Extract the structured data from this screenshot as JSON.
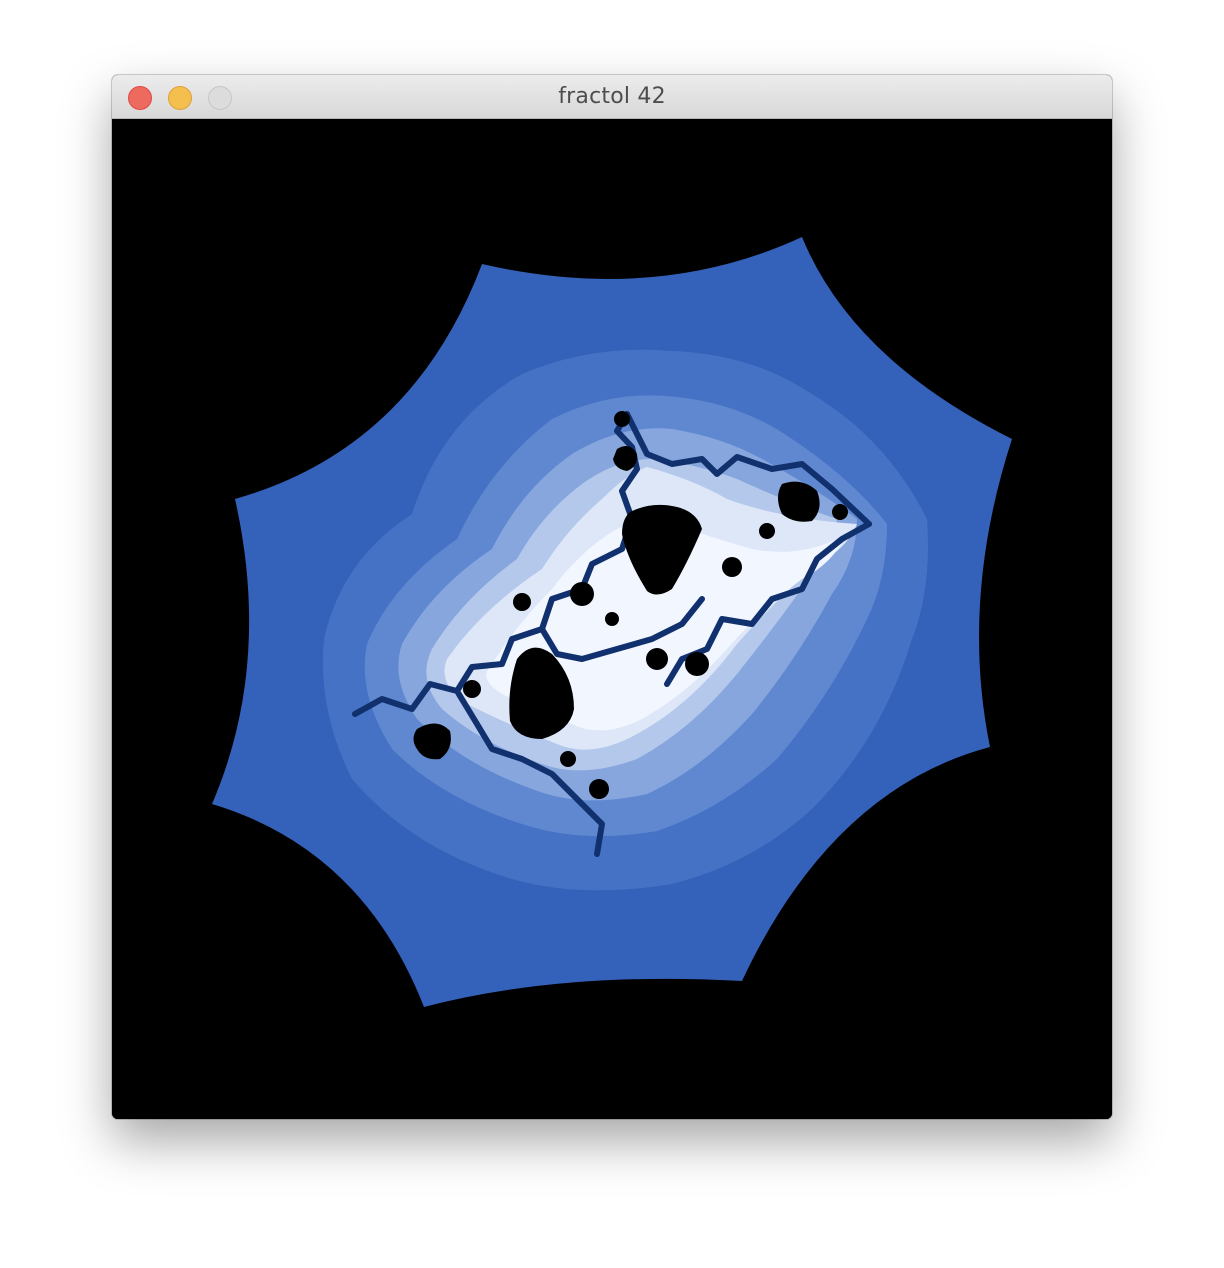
{
  "window": {
    "title": "fractol 42",
    "buttons": {
      "close": {
        "icon": "close-icon",
        "color": "#ed6a5e"
      },
      "minimize": {
        "icon": "minimize-icon",
        "color": "#f5bf4f"
      },
      "zoom": {
        "icon": "zoom-icon",
        "color": "#dcdcdc"
      }
    }
  },
  "canvas": {
    "background": "#000000",
    "palette": {
      "outer": "#3461b9",
      "band1": "#4572c4",
      "band2": "#5f88d0",
      "band3": "#86a6dd",
      "band4": "#b4c8ec",
      "band5": "#dde7f8",
      "core": "#f2f6ff",
      "set": "#000000",
      "filament": "#11316e"
    }
  }
}
